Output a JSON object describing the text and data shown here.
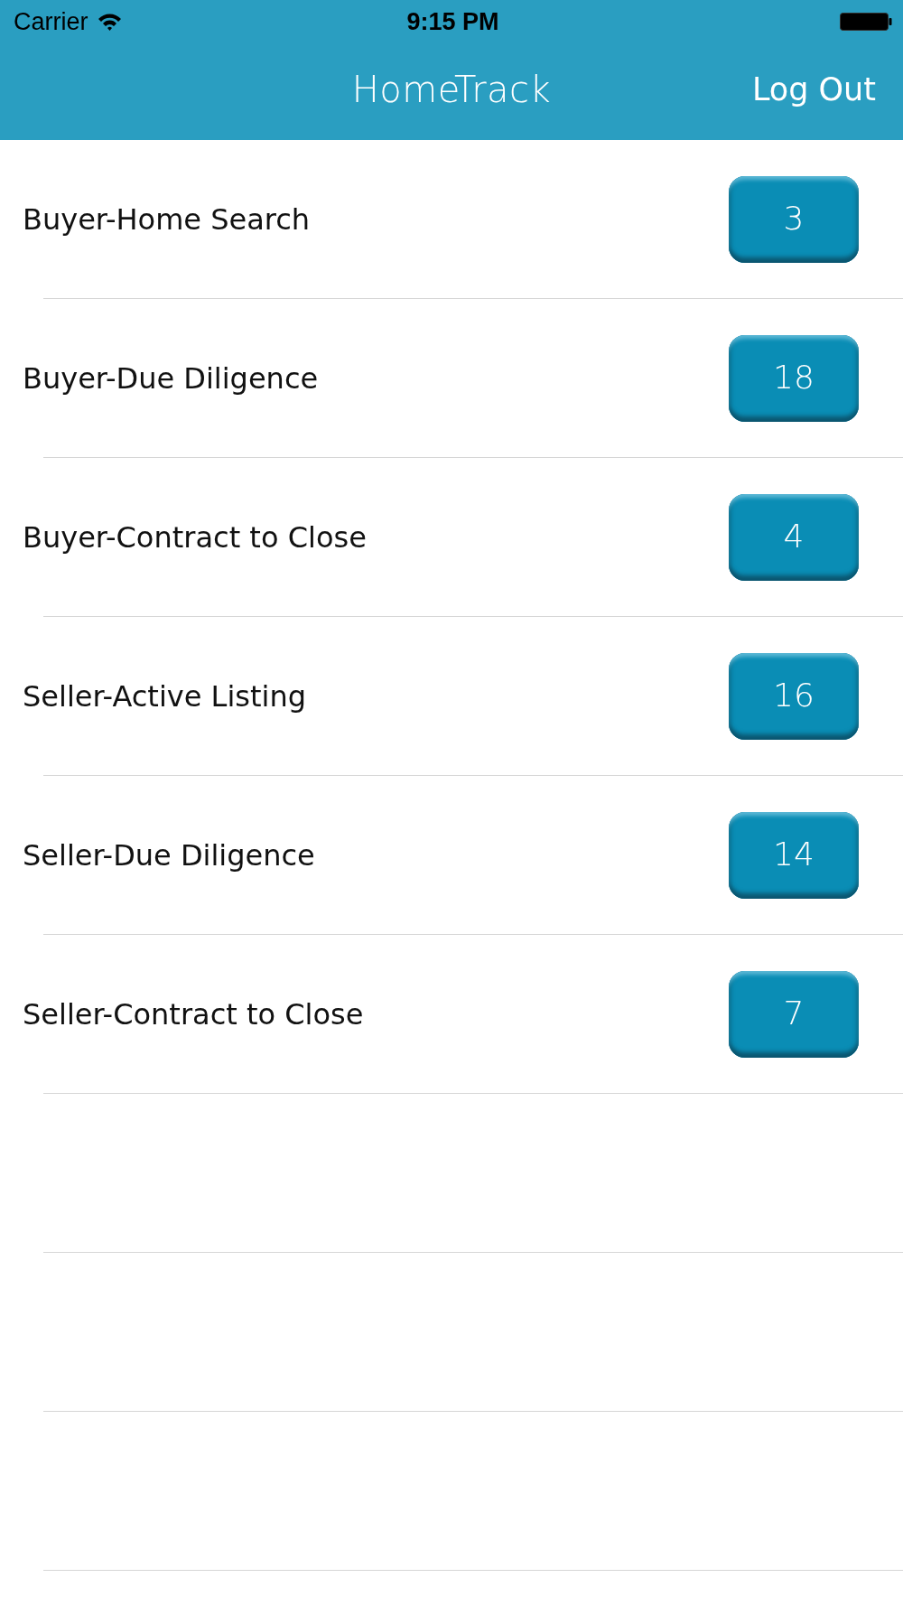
{
  "status_bar": {
    "carrier": "Carrier",
    "time": "9:15 PM"
  },
  "nav_bar": {
    "title": "HomeTrack",
    "right_button": "Log Out"
  },
  "list": {
    "rows": [
      {
        "label": "Buyer-Home Search",
        "count": "3"
      },
      {
        "label": "Buyer-Due Diligence",
        "count": "18"
      },
      {
        "label": "Buyer-Contract to Close",
        "count": "4"
      },
      {
        "label": "Seller-Active Listing",
        "count": "16"
      },
      {
        "label": "Seller-Due Diligence",
        "count": "14"
      },
      {
        "label": "Seller-Contract to Close",
        "count": "7"
      }
    ]
  }
}
